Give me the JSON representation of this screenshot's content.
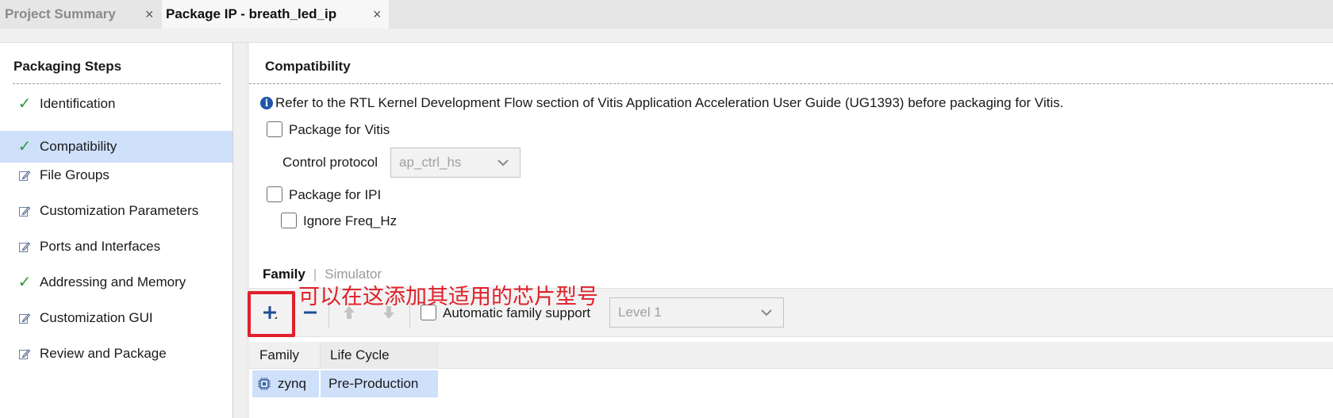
{
  "tabs": [
    {
      "label": "Project Summary",
      "close": "×"
    },
    {
      "label": "Package IP - breath_led_ip",
      "close": "×"
    }
  ],
  "left_panel": {
    "title": "Packaging Steps",
    "steps": [
      {
        "label": "Identification",
        "icon": "check-icon"
      },
      {
        "label": "Compatibility",
        "icon": "check-icon",
        "selected": true
      },
      {
        "label": "File Groups",
        "icon": "edit-icon"
      },
      {
        "label": "Customization Parameters",
        "icon": "edit-icon"
      },
      {
        "label": "Ports and Interfaces",
        "icon": "edit-icon"
      },
      {
        "label": "Addressing and Memory",
        "icon": "check-icon"
      },
      {
        "label": "Customization GUI",
        "icon": "edit-icon"
      },
      {
        "label": "Review and Package",
        "icon": "edit-icon"
      }
    ]
  },
  "main": {
    "title": "Compatibility",
    "info_text": "Refer to the RTL Kernel Development Flow section of Vitis Application Acceleration User Guide (UG1393) before packaging for Vitis.",
    "package_vitis_label": "Package for Vitis",
    "control_protocol_label": "Control protocol",
    "control_protocol_value": "ap_ctrl_hs",
    "package_ipi_label": "Package for IPI",
    "ignore_freq_label": "Ignore Freq_Hz",
    "subtabs": [
      "Family",
      "Simulator"
    ],
    "auto_family_label": "Automatic family support",
    "level_value": "Level 1",
    "table": {
      "headers": [
        "Family",
        "Life Cycle"
      ],
      "rows": [
        {
          "family": "zynq",
          "life_cycle": "Pre-Production"
        }
      ]
    }
  },
  "annotation": {
    "text": "可以在这添加其适用的芯片型号",
    "color": "#e0202a"
  },
  "colors": {
    "selection": "#cfe0fb",
    "check": "#2e9e3a",
    "toolbar_blue": "#1f4e96"
  }
}
